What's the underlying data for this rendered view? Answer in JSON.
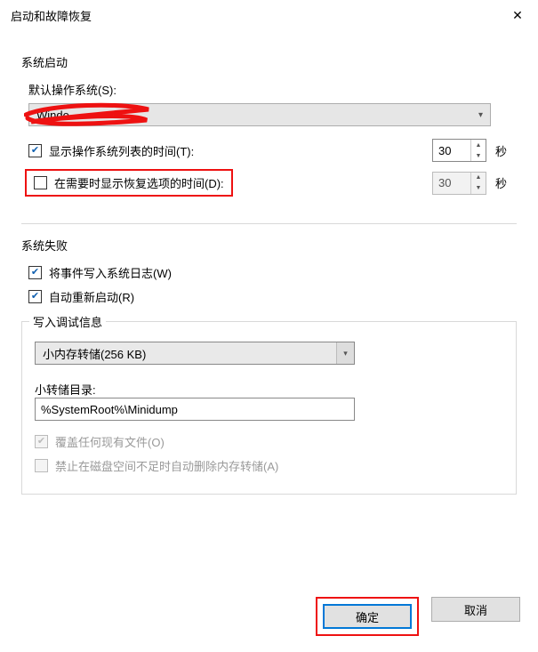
{
  "window": {
    "title": "启动和故障恢复"
  },
  "startup": {
    "heading": "系统启动",
    "default_os_label": "默认操作系统(S):",
    "default_os_value": "Windo",
    "show_os_list_label": "显示操作系统列表的时间(T):",
    "show_os_list_checked": true,
    "show_os_list_seconds": "30",
    "show_recovery_label": "在需要时显示恢复选项的时间(D):",
    "show_recovery_checked": false,
    "show_recovery_seconds": "30",
    "seconds_unit": "秒"
  },
  "failure": {
    "heading": "系统失败",
    "write_log_label": "将事件写入系统日志(W)",
    "write_log_checked": true,
    "auto_restart_label": "自动重新启动(R)",
    "auto_restart_checked": true,
    "debug_frame_title": "写入调试信息",
    "dump_type_value": "小内存转储(256 KB)",
    "dump_dir_label": "小转储目录:",
    "dump_dir_value": "%SystemRoot%\\Minidump",
    "overwrite_label": "覆盖任何现有文件(O)",
    "overwrite_checked": true,
    "disable_delete_label": "禁止在磁盘空间不足时自动删除内存转储(A)",
    "disable_delete_checked": false
  },
  "buttons": {
    "ok": "确定",
    "cancel": "取消"
  }
}
